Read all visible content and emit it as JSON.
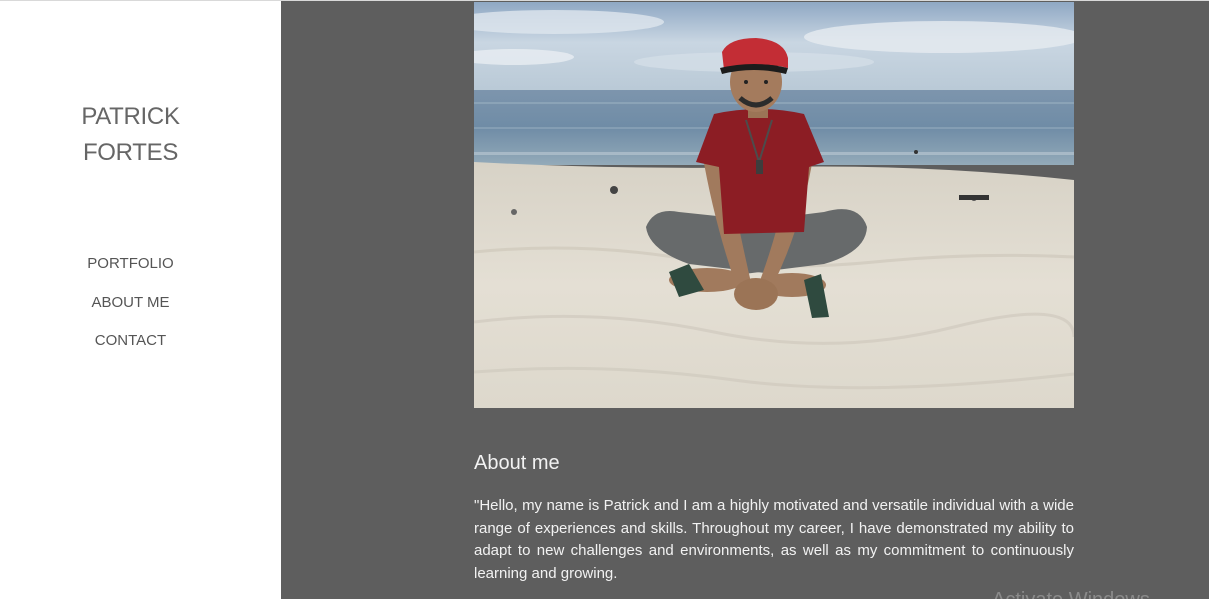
{
  "sidebar": {
    "title_line1": "PATRICK",
    "title_line2": "FORTES",
    "nav": [
      {
        "label": "PORTFOLIO"
      },
      {
        "label": "ABOUT ME"
      },
      {
        "label": "CONTACT"
      }
    ]
  },
  "main": {
    "heading": "About me",
    "paragraph": "\"Hello, my name is Patrick and I am a highly motivated and versatile individual with a wide range of experiences and skills. Throughout my career, I have demonstrated my ability to adapt to new challenges and environments, as well as my commitment to continuously learning and growing."
  },
  "watermark": "Activate Windows",
  "colors": {
    "main_background": "#5e5e5e",
    "sidebar_background": "#ffffff",
    "title_text": "#666666",
    "nav_text": "#555555",
    "body_text": "#f2f2f2"
  }
}
